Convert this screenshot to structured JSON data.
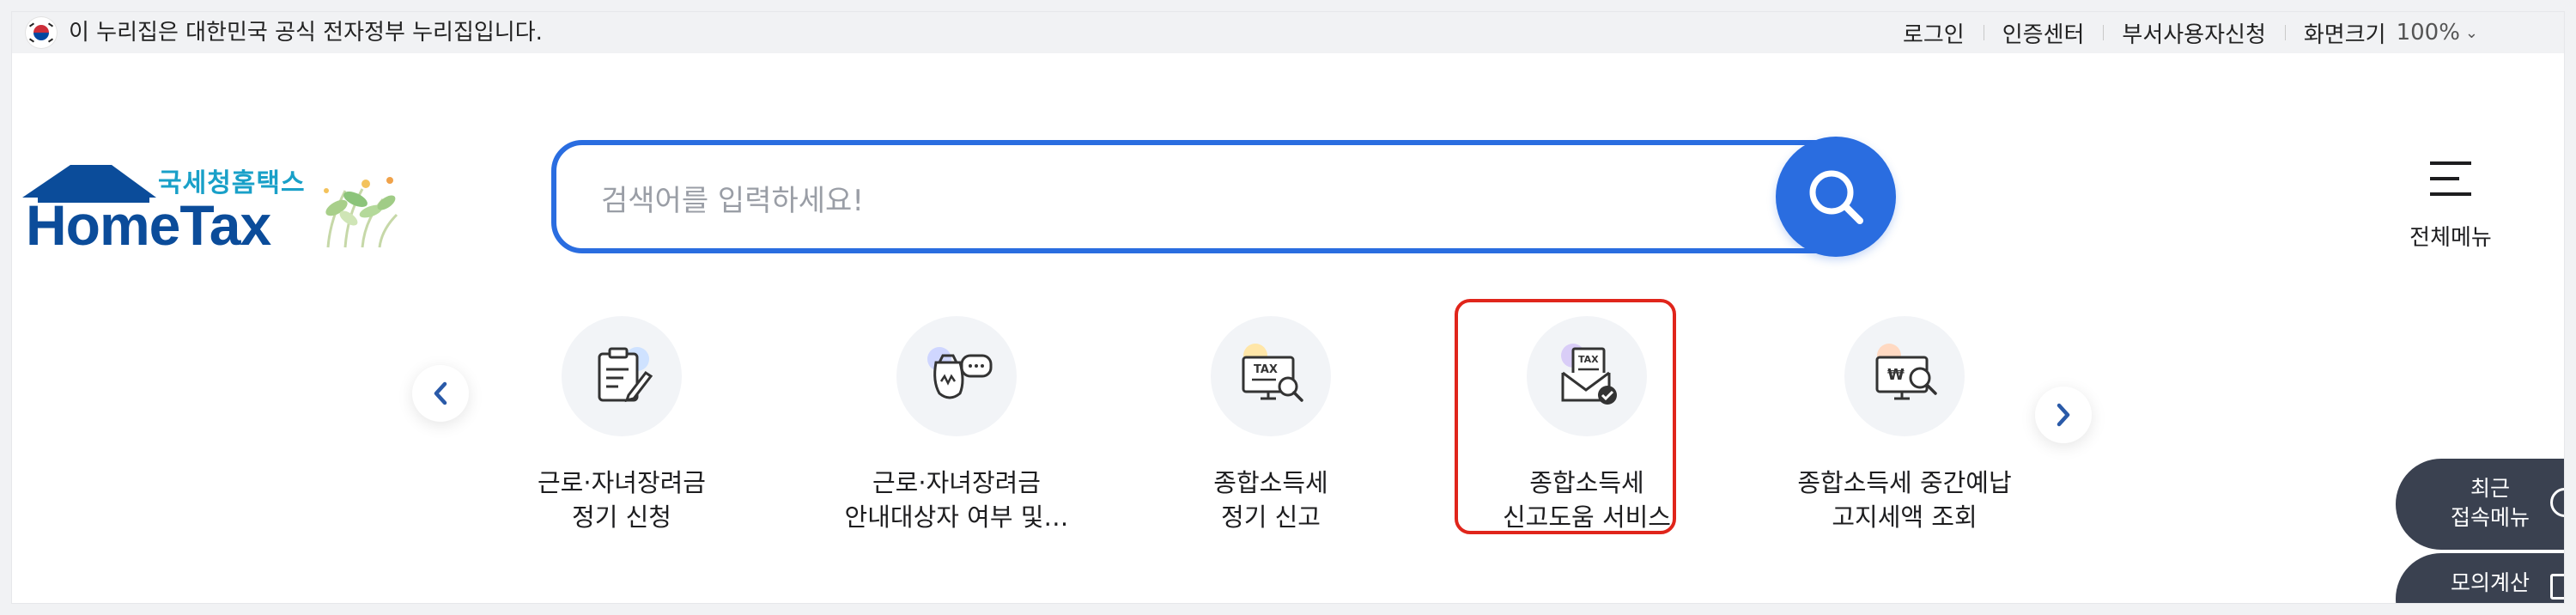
{
  "gov_banner": {
    "text": "이 누리집은 대한민국 공식 전자정부 누리집입니다."
  },
  "util_links": {
    "login": "로그인",
    "cert_center": "인증센터",
    "dept_user": "부서사용자신청",
    "zoom_label": "화면크기",
    "zoom_value": "100%"
  },
  "logo": {
    "brand_ko": "국세청홈택스",
    "brand_en": "HomeTax"
  },
  "search": {
    "placeholder": "검색어를 입력하세요!"
  },
  "all_menu": {
    "label": "전체메뉴"
  },
  "quick_services": [
    {
      "line1": "근로·자녀장려금",
      "line2": "정기 신청",
      "icon": "clipboard-pen-icon"
    },
    {
      "line1": "근로·자녀장려금",
      "line2": "안내대상자 여부 및…",
      "icon": "money-bag-chat-icon"
    },
    {
      "line1": "종합소득세",
      "line2": "정기 신고",
      "icon": "tax-monitor-icon"
    },
    {
      "line1": "종합소득세",
      "line2": "신고도움 서비스",
      "icon": "tax-envelope-check-icon"
    },
    {
      "line1": "종합소득세 중간예납",
      "line2": "고지세액 조회",
      "icon": "won-monitor-search-icon"
    }
  ],
  "floating": {
    "recent_line1": "최근",
    "recent_line2": "접속메뉴",
    "mock_label": "모의계산"
  },
  "colors": {
    "primary": "#2a6de0",
    "logo_navy": "#0b4c9a",
    "logo_cyan": "#19a0c8",
    "highlight": "#e0251b",
    "float_btn": "#3a4150"
  }
}
